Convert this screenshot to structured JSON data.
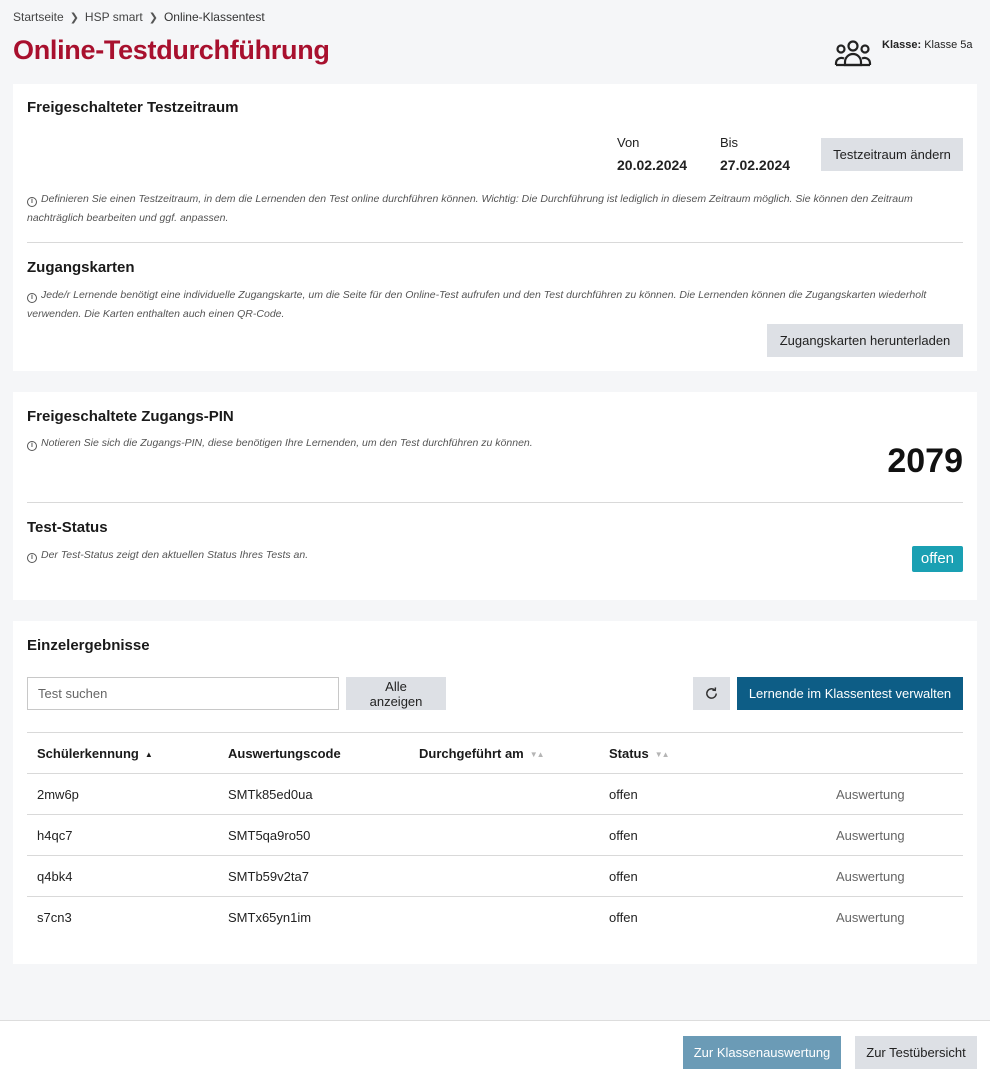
{
  "breadcrumb": {
    "items": [
      "Startseite",
      "HSP smart",
      "Online-Klassentest"
    ]
  },
  "page_title": "Online-Testdurchführung",
  "class_info": {
    "label": "Klasse:",
    "value": "Klasse 5a",
    "icon": "group-icon"
  },
  "test_period": {
    "title": "Freigeschalteter Testzeitraum",
    "from_label": "Von",
    "from_value": "20.02.2024",
    "to_label": "Bis",
    "to_value": "27.02.2024",
    "change_button": "Testzeitraum ändern",
    "hint": "Definieren Sie einen Testzeitraum, in dem die Lernenden den Test online durchführen können. Wichtig: Die Durchführung ist lediglich in diesem Zeitraum möglich. Sie können den Zeitraum nachträglich bearbeiten und ggf. anpassen."
  },
  "access_cards": {
    "title": "Zugangskarten",
    "hint": "Jede/r Lernende benötigt eine individuelle Zugangskarte, um die Seite für den Online-Test aufrufen und den Test durchführen zu können. Die Lernenden können die Zugangskarten wiederholt verwenden. Die Karten enthalten auch einen QR-Code.",
    "download_button": "Zugangskarten herunterladen"
  },
  "pin": {
    "title": "Freigeschaltete Zugangs-PIN",
    "hint": "Notieren Sie sich die Zugangs-PIN, diese benötigen Ihre Lernenden, um den Test durchführen zu können.",
    "value": "2079"
  },
  "test_status": {
    "title": "Test-Status",
    "hint": "Der Test-Status zeigt den aktuellen Status Ihres Tests an.",
    "value": "offen",
    "color": "#1aa0b3"
  },
  "results": {
    "title": "Einzelergebnisse",
    "search_placeholder": "Test suchen",
    "show_all_button": "Alle anzeigen",
    "manage_button": "Lernende im Klassentest verwalten",
    "columns": [
      "Schülerkennung",
      "Auswertungscode",
      "Durchgeführt am",
      "Status"
    ],
    "rows": [
      {
        "id": "2mw6p",
        "code": "SMTk85ed0ua",
        "date": "",
        "status": "offen",
        "action": "Auswertung"
      },
      {
        "id": "h4qc7",
        "code": "SMT5qa9ro50",
        "date": "",
        "status": "offen",
        "action": "Auswertung"
      },
      {
        "id": "q4bk4",
        "code": "SMTb59v2ta7",
        "date": "",
        "status": "offen",
        "action": "Auswertung"
      },
      {
        "id": "s7cn3",
        "code": "SMTx65yn1im",
        "date": "",
        "status": "offen",
        "action": "Auswertung"
      }
    ]
  },
  "footer": {
    "class_eval_button": "Zur Klassenauswertung",
    "overview_button": "Zur Testübersicht"
  },
  "colors": {
    "accent_red": "#a8102e",
    "primary_blue": "#0d5d86",
    "muted_blue": "#6b9bb6"
  }
}
